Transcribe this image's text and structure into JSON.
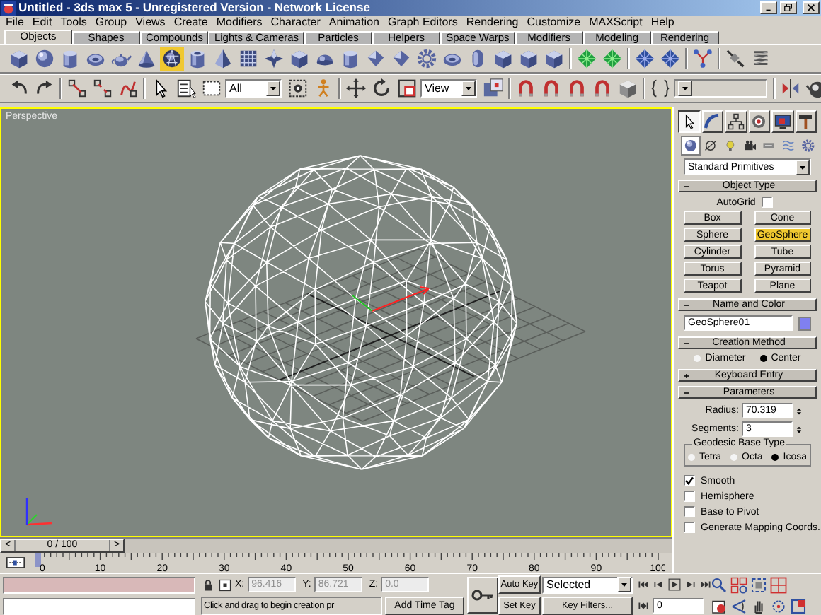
{
  "window": {
    "title": "Untitled - 3ds max 5 - Unregistered Version - Network License"
  },
  "menu": [
    "File",
    "Edit",
    "Tools",
    "Group",
    "Views",
    "Create",
    "Modifiers",
    "Character",
    "Animation",
    "Graph Editors",
    "Rendering",
    "Customize",
    "MAXScript",
    "Help"
  ],
  "tabs": [
    {
      "label": "Objects",
      "selected": true
    },
    {
      "label": "Shapes",
      "selected": false
    },
    {
      "label": "Compounds",
      "selected": false
    },
    {
      "label": "Lights & Cameras",
      "selected": false
    },
    {
      "label": "Particles",
      "selected": false
    },
    {
      "label": "Helpers",
      "selected": false
    },
    {
      "label": "Space Warps",
      "selected": false
    },
    {
      "label": "Modifiers",
      "selected": false
    },
    {
      "label": "Modeling",
      "selected": false
    },
    {
      "label": "Rendering",
      "selected": false
    }
  ],
  "create_toolbar": {
    "groups": [
      {
        "items": [
          {
            "kind": "box",
            "selected": false
          },
          {
            "kind": "sphere",
            "selected": false
          },
          {
            "kind": "cylinder",
            "selected": false
          },
          {
            "kind": "torus",
            "selected": false
          },
          {
            "kind": "teapot",
            "selected": false
          },
          {
            "kind": "cone",
            "selected": false
          },
          {
            "kind": "geosphere",
            "selected": true
          },
          {
            "kind": "tube",
            "selected": false
          },
          {
            "kind": "pyramid",
            "selected": false
          },
          {
            "kind": "plane",
            "selected": false
          },
          {
            "kind": "hedra",
            "selected": false
          },
          {
            "kind": "chamferbox",
            "selected": false
          },
          {
            "kind": "dome",
            "selected": false
          },
          {
            "kind": "oiltank",
            "selected": false
          },
          {
            "kind": "spindle",
            "selected": false
          },
          {
            "kind": "gengon",
            "selected": false
          },
          {
            "kind": "ringwave",
            "selected": false
          },
          {
            "kind": "torusknot",
            "selected": false
          },
          {
            "kind": "capsule",
            "selected": false
          },
          {
            "kind": "lext",
            "selected": false
          },
          {
            "kind": "cext",
            "selected": false
          },
          {
            "kind": "prism",
            "selected": false
          }
        ]
      },
      {
        "items": [
          {
            "kind": "patch",
            "selected": false
          },
          {
            "kind": "patch",
            "selected": false
          }
        ]
      },
      {
        "items": [
          {
            "kind": "nurbs",
            "selected": false
          },
          {
            "kind": "nurbs",
            "selected": false
          }
        ]
      },
      {
        "items": [
          {
            "kind": "bone",
            "selected": false
          }
        ]
      },
      {
        "items": [
          {
            "kind": "plug",
            "selected": false
          },
          {
            "kind": "spring",
            "selected": false
          }
        ]
      }
    ]
  },
  "main_toolbar": {
    "groups": [
      {
        "items": [
          {
            "kind": "undo"
          },
          {
            "kind": "redo"
          }
        ]
      },
      {
        "items": [
          {
            "kind": "link"
          },
          {
            "kind": "unlink"
          },
          {
            "kind": "bind"
          }
        ]
      },
      {
        "items": [
          {
            "kind": "select"
          },
          {
            "kind": "select_by_name"
          },
          {
            "kind": "rect_select"
          },
          {
            "kind": "dropdown",
            "value": "All"
          },
          {
            "kind": "crossing"
          },
          {
            "kind": "figure"
          }
        ]
      },
      {
        "items": [
          {
            "kind": "move"
          },
          {
            "kind": "rotate"
          },
          {
            "kind": "scale"
          },
          {
            "kind": "dropdown",
            "value": "View"
          },
          {
            "kind": "pivot"
          }
        ]
      },
      {
        "items": [
          {
            "kind": "snap"
          },
          {
            "kind": "snap"
          },
          {
            "kind": "snap"
          },
          {
            "kind": "snap"
          },
          {
            "kind": "cube"
          }
        ]
      },
      {
        "items": [
          {
            "kind": "braces"
          },
          {
            "kind": "combo"
          }
        ]
      },
      {
        "items": [
          {
            "kind": "mirror"
          },
          {
            "kind": "render"
          }
        ]
      }
    ]
  },
  "viewport": {
    "label": "Perspective",
    "active": true
  },
  "command_panel": {
    "tabs": [
      {
        "kind": "create",
        "selected": true
      },
      {
        "kind": "modify",
        "selected": false
      },
      {
        "kind": "hierarchy",
        "selected": false
      },
      {
        "kind": "motion",
        "selected": false
      },
      {
        "kind": "display",
        "selected": false
      },
      {
        "kind": "utilities",
        "selected": false
      }
    ],
    "categories": [
      {
        "kind": "geometry",
        "selected": true
      },
      {
        "kind": "shapes",
        "selected": false
      },
      {
        "kind": "lights",
        "selected": false
      },
      {
        "kind": "cameras",
        "selected": false
      },
      {
        "kind": "helpers",
        "selected": false
      },
      {
        "kind": "space_warps",
        "selected": false
      },
      {
        "kind": "systems",
        "selected": false
      }
    ],
    "object_category": "Standard Primitives",
    "rollouts": [
      {
        "kind": "object_type",
        "title": "Object Type",
        "expanded": true,
        "autogrid": {
          "label": "AutoGrid",
          "checked": false
        },
        "buttons": [
          {
            "label": "Box",
            "selected": false
          },
          {
            "label": "Cone",
            "selected": false
          },
          {
            "label": "Sphere",
            "selected": false
          },
          {
            "label": "GeoSphere",
            "selected": true
          },
          {
            "label": "Cylinder",
            "selected": false
          },
          {
            "label": "Tube",
            "selected": false
          },
          {
            "label": "Torus",
            "selected": false
          },
          {
            "label": "Pyramid",
            "selected": false
          },
          {
            "label": "Teapot",
            "selected": false
          },
          {
            "label": "Plane",
            "selected": false
          }
        ]
      },
      {
        "kind": "name_color",
        "title": "Name and Color",
        "expanded": true,
        "name": "GeoSphere01",
        "color": "#8080f0"
      },
      {
        "kind": "creation_method",
        "title": "Creation Method",
        "expanded": true,
        "options": [
          {
            "label": "Diameter",
            "selected": false
          },
          {
            "label": "Center",
            "selected": true
          }
        ]
      },
      {
        "kind": "keyboard_entry",
        "title": "Keyboard Entry",
        "expanded": false
      },
      {
        "kind": "parameters",
        "title": "Parameters",
        "expanded": true,
        "spinners": [
          {
            "label": "Radius:",
            "value": "70.319"
          },
          {
            "label": "Segments:",
            "value": "3"
          }
        ],
        "base_type": {
          "title": "Geodesic Base Type",
          "options": [
            {
              "label": "Tetra",
              "selected": false
            },
            {
              "label": "Octa",
              "selected": false
            },
            {
              "label": "Icosa",
              "selected": true
            }
          ]
        },
        "checks": [
          {
            "label": "Smooth",
            "checked": true
          },
          {
            "label": "Hemisphere",
            "checked": false
          },
          {
            "label": "Base to Pivot",
            "checked": false
          },
          {
            "label": "Generate Mapping Coords.",
            "checked": false
          }
        ]
      }
    ]
  },
  "time_slider": {
    "prev": "<",
    "position": "0 / 100",
    "next": ">",
    "level": 0
  },
  "track": {
    "labels": [
      "0",
      "10",
      "20",
      "30",
      "40",
      "50",
      "60",
      "70",
      "80",
      "90",
      "100"
    ]
  },
  "status": {
    "prompt": "Click and drag to begin creation pr",
    "time_tag": "Add Time Tag",
    "coords": [
      {
        "label": "X:",
        "value": "96.416",
        "disabled": true
      },
      {
        "label": "Y:",
        "value": "86.721",
        "disabled": true
      },
      {
        "label": "Z:",
        "value": "0.0",
        "disabled": true
      }
    ]
  },
  "animation": {
    "auto_key": "Auto Key",
    "key_mode": "Selected",
    "set_key": "Set Key",
    "key_filters": "Key Filters...",
    "frame": "0"
  }
}
